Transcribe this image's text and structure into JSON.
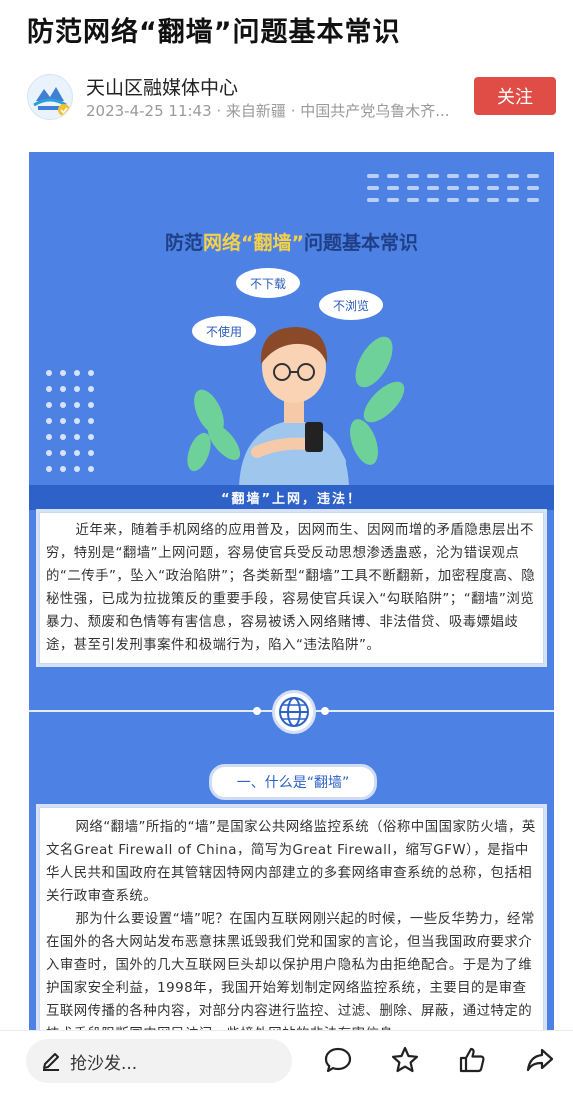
{
  "article": {
    "title": "防范网络“翻墙”问题基本常识",
    "account_name": "天山区融媒体中心",
    "meta": "2023-4-25 11:43 · 来自新疆 · 中国共产党乌鲁木齐...",
    "follow_label": "关注"
  },
  "poster": {
    "title_pre": "防范",
    "title_hl1": "网络",
    "title_hl2": "“翻墙”",
    "title_post": "问题基本常识",
    "bubbles": [
      "不下载",
      "不浏览",
      "不使用"
    ],
    "ribbon": "“翻墙”上网，违法！",
    "intro": "近年来，随着手机网络的应用普及，因网而生、因网而增的矛盾隐患层出不穷，特别是“翻墙”上网问题，容易使官兵受反动思想渗透蛊惑，沦为错误观点的“二传手”，坠入“政治陷阱”；各类新型“翻墙”工具不断翻新，加密程度高、隐秘性强，已成为拉拢策反的重要手段，容易使官兵误入“勾联陷阱”；“翻墙”浏览暴力、颓废和色情等有害信息，容易被诱入网络赌博、非法借贷、吸毒嫖娼歧途，甚至引发刑事案件和极端行为，陷入“违法陷阱”。",
    "section_title": "一、什么是“翻墙”",
    "section_p1": "网络“翻墙”所指的“墙”是国家公共网络监控系统（俗称中国国家防火墙，英文名Great Firewall of China，简写为Great Firewall，缩写GFW），是指中华人民共和国政府在其管辖因特网内部建立的多套网络审查系统的总称，包括相关行政审查系统。",
    "section_p2": "那为什么要设置“墙”呢？在国内互联网刚兴起的时候，一些反华势力，经常在国外的各大网站发布恶意抹黑诋毁我们党和国家的言论，但当我国政府要求介入审查时，国外的几大互联网巨头却以保护用户隐私为由拒绝配合。于是为了维护国家安全利益，1998年，我国开始筹划制定网络监控系统，主要目的是审查互联网传播的各种内容，对部分内容进行监控、过滤、删除、屏蔽，通过特定的技术手段阻断国内网民访问一些境外网站的非法有害信息。"
  },
  "bottom_bar": {
    "comment_placeholder": "抢沙发..."
  },
  "colors": {
    "poster_bg": "#4d82e4",
    "follow_bg": "#e04c46",
    "ribbon_bg": "#2e62c8"
  },
  "icons": [
    "pen-icon",
    "comment-icon",
    "star-icon",
    "thumbs-up-icon",
    "share-icon",
    "globe-icon"
  ]
}
